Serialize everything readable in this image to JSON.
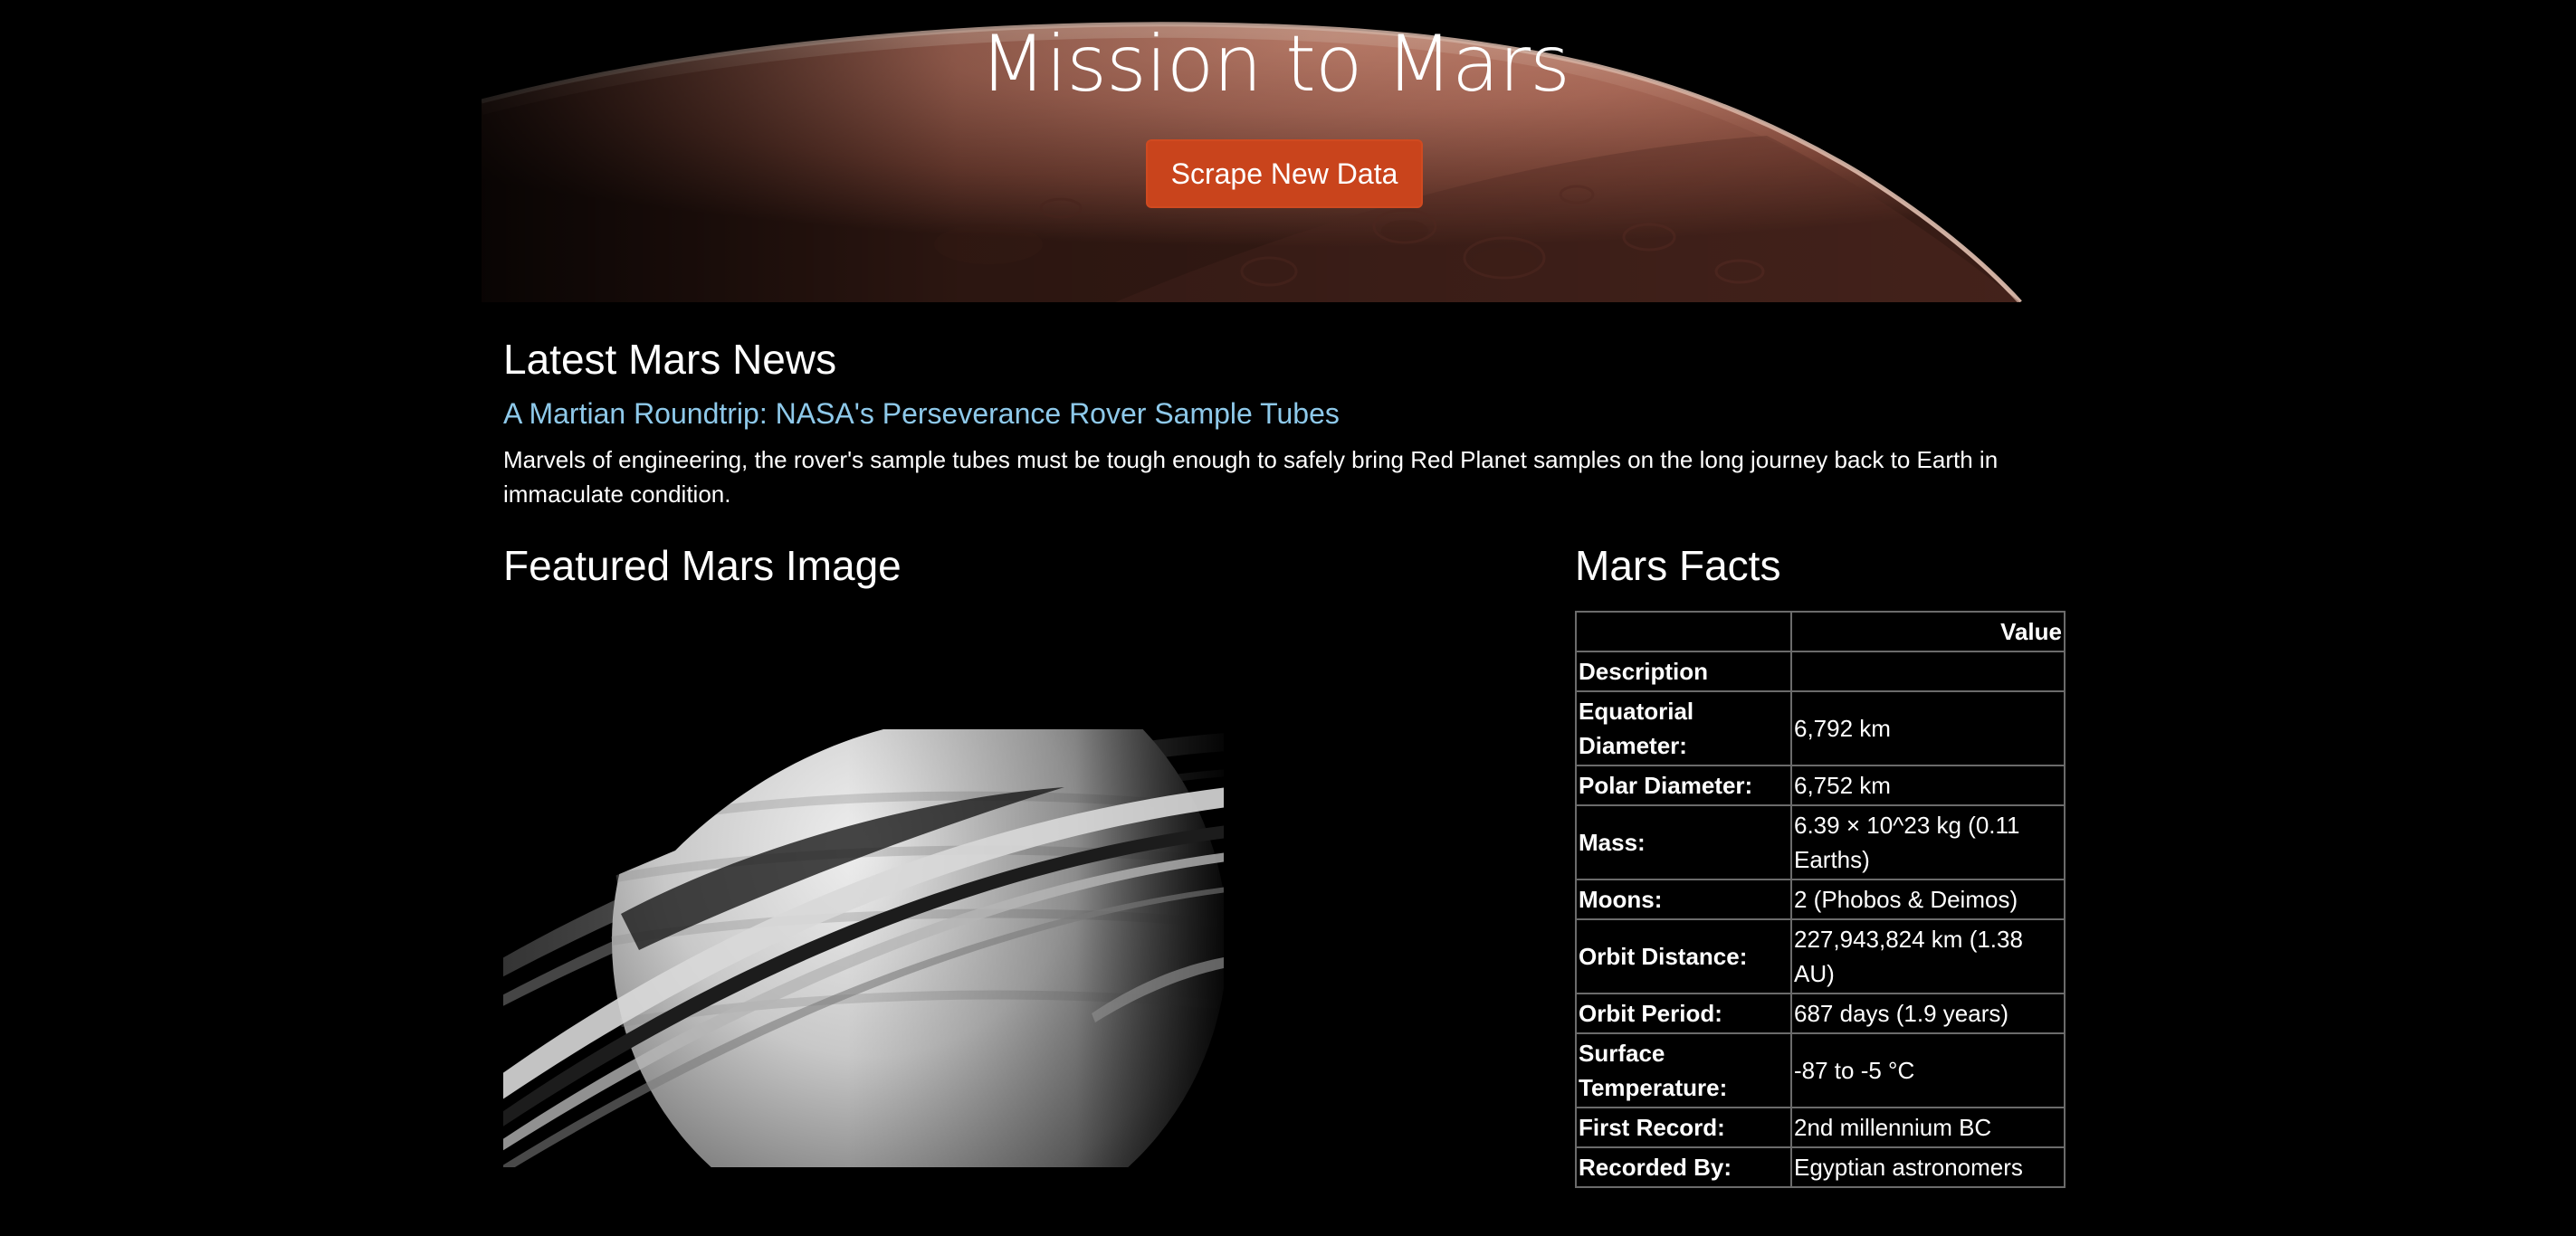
{
  "header": {
    "title": "Mission to Mars",
    "scrape_button_label": "Scrape New Data"
  },
  "news": {
    "heading": "Latest Mars News",
    "title": "A Martian Roundtrip: NASA's Perseverance Rover Sample Tubes",
    "teaser": "Marvels of engineering, the rover's sample tubes must be tough enough to safely bring Red Planet samples on the long journey back to Earth in immaculate condition."
  },
  "featured_image": {
    "heading": "Featured Mars Image"
  },
  "facts": {
    "heading": "Mars Facts",
    "columns": [
      "",
      "Value"
    ],
    "index_label": "Description",
    "rows": [
      {
        "label": "Equatorial Diameter:",
        "value": "6,792 km"
      },
      {
        "label": "Polar Diameter:",
        "value": "6,752 km"
      },
      {
        "label": "Mass:",
        "value": "6.39 × 10^23 kg (0.11 Earths)"
      },
      {
        "label": "Moons:",
        "value": "2 (Phobos & Deimos)"
      },
      {
        "label": "Orbit Distance:",
        "value": "227,943,824 km (1.38 AU)"
      },
      {
        "label": "Orbit Period:",
        "value": "687 days (1.9 years)"
      },
      {
        "label": "Surface Temperature:",
        "value": "-87 to -5 °C"
      },
      {
        "label": "First Record:",
        "value": "2nd millennium BC"
      },
      {
        "label": "Recorded By:",
        "value": "Egyptian astronomers"
      }
    ]
  },
  "colors": {
    "background": "#000000",
    "button": "#c9441c",
    "link": "#8ec9ea",
    "table_border": "#6b6b6b"
  }
}
